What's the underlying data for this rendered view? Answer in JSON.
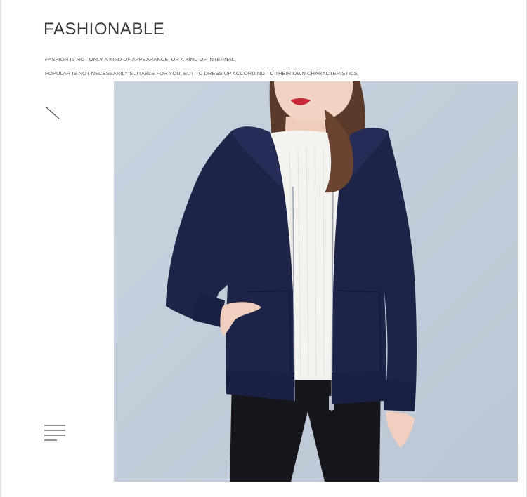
{
  "header": {
    "title": "FASHIONABLE",
    "line1": "FASHION IS NOT ONLY A KIND OF APPEARANCE, OR A KIND OF INTERNAL,",
    "line2": "POPULAR IS NOT NECESSARILY SUITABLE FOR YOU, BUT TO DRESS UP ACCORDING TO THEIR OWN CHARACTERISTICS,"
  },
  "decor": {
    "slash_icon": "diagonal-line-icon",
    "menu_icon": "menu-lines-icon"
  },
  "photo": {
    "background_color": "#c6cfdc",
    "jacket_color": "#1e2447",
    "sweater_color": "#f4f3ef",
    "pants_color": "#15161c",
    "hair_color": "#5a3a28",
    "skin_color": "#f1d3c3",
    "lip_color": "#c8283a"
  }
}
